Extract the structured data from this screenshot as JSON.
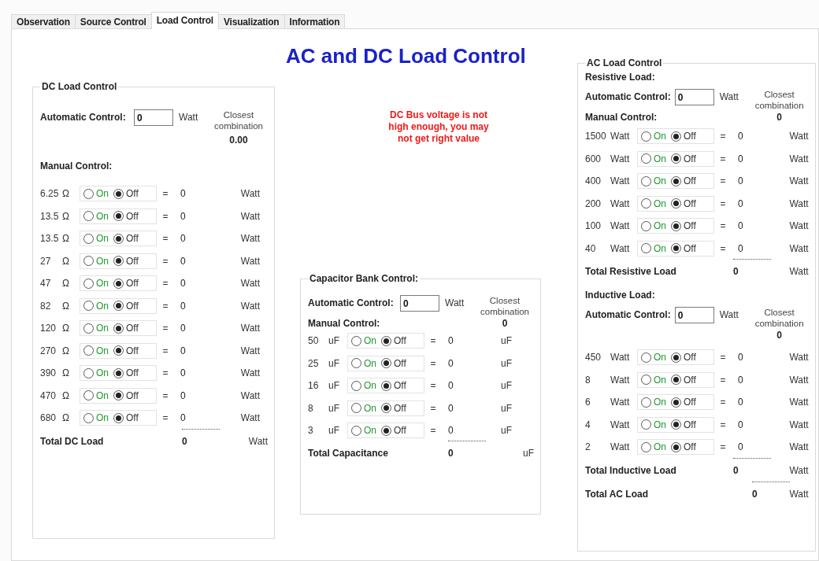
{
  "tabs": [
    {
      "label": "Observation",
      "selected": false
    },
    {
      "label": "Source Control",
      "selected": false
    },
    {
      "label": "Load Control",
      "selected": true
    },
    {
      "label": "Visualization",
      "selected": false
    },
    {
      "label": "Information",
      "selected": false
    }
  ],
  "title": "AC and DC Load Control",
  "warning": "DC Bus voltage is not high enough, you may not get right value",
  "dc_load_control": {
    "title": "DC Load Control",
    "automatic": {
      "label": "Automatic Control:",
      "value": "0",
      "unit": "Watt",
      "closest_label": "Closest combination",
      "closest_value": "0.00"
    },
    "manual_label": "Manual Control:",
    "rows": [
      {
        "rating": "6.25",
        "unit": "Ω",
        "on_label": "On",
        "off_label": "Off",
        "on": false,
        "equals": "=",
        "result": "0",
        "result_unit": "Watt"
      },
      {
        "rating": "13.5",
        "unit": "Ω",
        "on_label": "On",
        "off_label": "Off",
        "on": false,
        "equals": "=",
        "result": "0",
        "result_unit": "Watt"
      },
      {
        "rating": "13.5",
        "unit": "Ω",
        "on_label": "On",
        "off_label": "Off",
        "on": false,
        "equals": "=",
        "result": "0",
        "result_unit": "Watt"
      },
      {
        "rating": "27",
        "unit": "Ω",
        "on_label": "On",
        "off_label": "Off",
        "on": false,
        "equals": "=",
        "result": "0",
        "result_unit": "Watt"
      },
      {
        "rating": "47",
        "unit": "Ω",
        "on_label": "On",
        "off_label": "Off",
        "on": false,
        "equals": "=",
        "result": "0",
        "result_unit": "Watt"
      },
      {
        "rating": "82",
        "unit": "Ω",
        "on_label": "On",
        "off_label": "Off",
        "on": false,
        "equals": "=",
        "result": "0",
        "result_unit": "Watt"
      },
      {
        "rating": "120",
        "unit": "Ω",
        "on_label": "On",
        "off_label": "Off",
        "on": false,
        "equals": "=",
        "result": "0",
        "result_unit": "Watt"
      },
      {
        "rating": "270",
        "unit": "Ω",
        "on_label": "On",
        "off_label": "Off",
        "on": false,
        "equals": "=",
        "result": "0",
        "result_unit": "Watt"
      },
      {
        "rating": "390",
        "unit": "Ω",
        "on_label": "On",
        "off_label": "Off",
        "on": false,
        "equals": "=",
        "result": "0",
        "result_unit": "Watt"
      },
      {
        "rating": "470",
        "unit": "Ω",
        "on_label": "On",
        "off_label": "Off",
        "on": false,
        "equals": "=",
        "result": "0",
        "result_unit": "Watt"
      },
      {
        "rating": "680",
        "unit": "Ω",
        "on_label": "On",
        "off_label": "Off",
        "on": false,
        "equals": "=",
        "result": "0",
        "result_unit": "Watt"
      }
    ],
    "total": {
      "label": "Total DC Load",
      "value": "0",
      "unit": "Watt"
    }
  },
  "capacitor_bank_control": {
    "title": "Capacitor Bank Control:",
    "automatic": {
      "label": "Automatic Control:",
      "value": "0",
      "unit": "Watt",
      "closest_label": "Closest combination",
      "closest_value": "0"
    },
    "manual_label": "Manual Control:",
    "rows": [
      {
        "rating": "50",
        "unit": "uF",
        "on_label": "On",
        "off_label": "Off",
        "on": false,
        "equals": "=",
        "result": "0",
        "result_unit": "uF"
      },
      {
        "rating": "25",
        "unit": "uF",
        "on_label": "On",
        "off_label": "Off",
        "on": false,
        "equals": "=",
        "result": "0",
        "result_unit": "uF"
      },
      {
        "rating": "16",
        "unit": "uF",
        "on_label": "On",
        "off_label": "Off",
        "on": false,
        "equals": "=",
        "result": "0",
        "result_unit": "uF"
      },
      {
        "rating": "8",
        "unit": "uF",
        "on_label": "On",
        "off_label": "Off",
        "on": false,
        "equals": "=",
        "result": "0",
        "result_unit": "uF"
      },
      {
        "rating": "3",
        "unit": "uF",
        "on_label": "On",
        "off_label": "Off",
        "on": false,
        "equals": "=",
        "result": "0",
        "result_unit": "uF"
      }
    ],
    "total": {
      "label": "Total Capacitance",
      "value": "0",
      "unit": "uF"
    }
  },
  "ac_load_control": {
    "title": "AC Load Control",
    "sections": [
      {
        "heading": "Resistive Load:",
        "automatic": {
          "label": "Automatic Control:",
          "value": "0",
          "unit": "Watt",
          "closest_label": "Closest combination",
          "closest_value": "0"
        },
        "manual_label": "Manual Control:",
        "rows": [
          {
            "rating": "1500",
            "unit": "Watt",
            "on_label": "On",
            "off_label": "Off",
            "on": false,
            "equals": "=",
            "result": "0",
            "result_unit": "Watt"
          },
          {
            "rating": "600",
            "unit": "Watt",
            "on_label": "On",
            "off_label": "Off",
            "on": false,
            "equals": "=",
            "result": "0",
            "result_unit": "Watt"
          },
          {
            "rating": "400",
            "unit": "Watt",
            "on_label": "On",
            "off_label": "Off",
            "on": false,
            "equals": "=",
            "result": "0",
            "result_unit": "Watt"
          },
          {
            "rating": "200",
            "unit": "Watt",
            "on_label": "On",
            "off_label": "Off",
            "on": false,
            "equals": "=",
            "result": "0",
            "result_unit": "Watt"
          },
          {
            "rating": "100",
            "unit": "Watt",
            "on_label": "On",
            "off_label": "Off",
            "on": false,
            "equals": "=",
            "result": "0",
            "result_unit": "Watt"
          },
          {
            "rating": "40",
            "unit": "Watt",
            "on_label": "On",
            "off_label": "Off",
            "on": false,
            "equals": "=",
            "result": "0",
            "result_unit": "Watt"
          }
        ],
        "total": {
          "label": "Total Resistive Load",
          "value": "0",
          "unit": "Watt"
        }
      },
      {
        "heading": "Inductive Load:",
        "automatic": {
          "label": "Automatic Control:",
          "value": "0",
          "unit": "Watt",
          "closest_label": "Closest combination",
          "closest_value": "0"
        },
        "rows": [
          {
            "rating": "450",
            "unit": "Watt",
            "on_label": "On",
            "off_label": "Off",
            "on": false,
            "equals": "=",
            "result": "0",
            "result_unit": "Watt"
          },
          {
            "rating": "8",
            "unit": "Watt",
            "on_label": "On",
            "off_label": "Off",
            "on": false,
            "equals": "=",
            "result": "0",
            "result_unit": "Watt"
          },
          {
            "rating": "6",
            "unit": "Watt",
            "on_label": "On",
            "off_label": "Off",
            "on": false,
            "equals": "=",
            "result": "0",
            "result_unit": "Watt"
          },
          {
            "rating": "4",
            "unit": "Watt",
            "on_label": "On",
            "off_label": "Off",
            "on": false,
            "equals": "=",
            "result": "0",
            "result_unit": "Watt"
          },
          {
            "rating": "2",
            "unit": "Watt",
            "on_label": "On",
            "off_label": "Off",
            "on": false,
            "equals": "=",
            "result": "0",
            "result_unit": "Watt"
          }
        ],
        "total": {
          "label": "Total Inductive Load",
          "value": "0",
          "unit": "Watt"
        }
      }
    ],
    "total": {
      "label": "Total AC Load",
      "value": "0",
      "unit": "Watt"
    }
  }
}
